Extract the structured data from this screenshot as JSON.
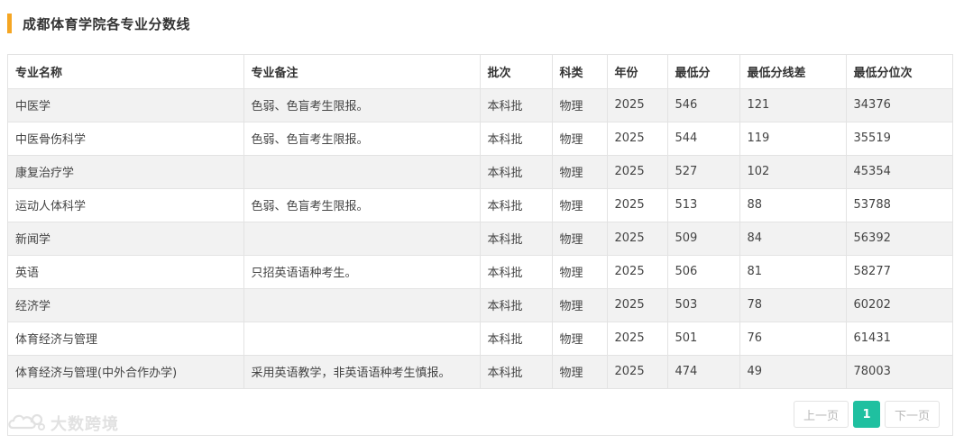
{
  "page_title": "成都体育学院各专业分数线",
  "accent_color": "#f5a623",
  "active_color": "#1fc0a0",
  "table": {
    "headers": [
      "专业名称",
      "专业备注",
      "批次",
      "科类",
      "年份",
      "最低分",
      "最低分线差",
      "最低分位次"
    ],
    "rows": [
      [
        "中医学",
        "色弱、色盲考生限报。",
        "本科批",
        "物理",
        "2025",
        "546",
        "121",
        "34376"
      ],
      [
        "中医骨伤科学",
        "色弱、色盲考生限报。",
        "本科批",
        "物理",
        "2025",
        "544",
        "119",
        "35519"
      ],
      [
        "康复治疗学",
        "",
        "本科批",
        "物理",
        "2025",
        "527",
        "102",
        "45354"
      ],
      [
        "运动人体科学",
        "色弱、色盲考生限报。",
        "本科批",
        "物理",
        "2025",
        "513",
        "88",
        "53788"
      ],
      [
        "新闻学",
        "",
        "本科批",
        "物理",
        "2025",
        "509",
        "84",
        "56392"
      ],
      [
        "英语",
        "只招英语语种考生。",
        "本科批",
        "物理",
        "2025",
        "506",
        "81",
        "58277"
      ],
      [
        "经济学",
        "",
        "本科批",
        "物理",
        "2025",
        "503",
        "78",
        "60202"
      ],
      [
        "体育经济与管理",
        "",
        "本科批",
        "物理",
        "2025",
        "501",
        "76",
        "61431"
      ],
      [
        "体育经济与管理(中外合作办学)",
        "采用英语教学，非英语语种考生慎报。",
        "本科批",
        "物理",
        "2025",
        "474",
        "49",
        "78003"
      ]
    ]
  },
  "pagination": {
    "prev_label": "上一页",
    "current_page": "1",
    "next_label": "下一页"
  },
  "watermark": {
    "text": "大数跨境",
    "icon": "cloud-logo-icon"
  }
}
